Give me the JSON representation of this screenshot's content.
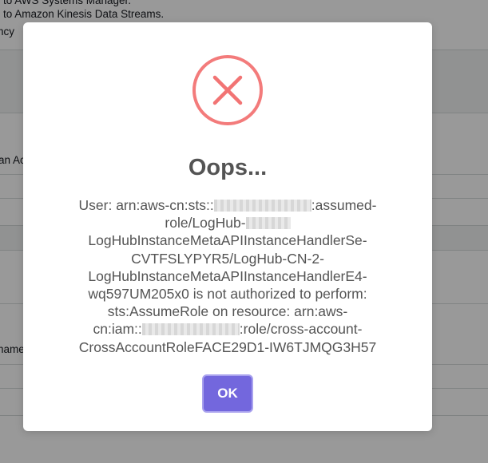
{
  "background": {
    "lines": [
      "to AWS Systems Manager.",
      "to Amazon Kinesis Data Streams.",
      "ncy",
      "an Ac",
      "name"
    ]
  },
  "modal": {
    "icon": "error-x-icon",
    "title": "Oops...",
    "message": {
      "line1_start": "User: arn:aws-cn:sts::",
      "line1_end": ":assumed-",
      "line2_start": "role/LogHub-",
      "line3": "LogHubInstanceMetaAPIInstanceHandlerSe-",
      "line4": "CVTFSLYPYR5/LogHub-CN-2-",
      "line5": "LogHubInstanceMetaAPIInstanceHandlerE4-",
      "line6": "wq597UM205x0 is not authorized to perform:",
      "line7": "sts:AssumeRole on resource: arn:aws-",
      "line8_start": "cn:iam::",
      "line8_end": ":role/cross-account-",
      "line9": "CrossAccountRoleFACE29D1-IW6TJMQG3H57"
    },
    "ok_label": "OK"
  },
  "colors": {
    "error_red": "#f27474",
    "button": "#7367dd",
    "text": "#545454"
  }
}
